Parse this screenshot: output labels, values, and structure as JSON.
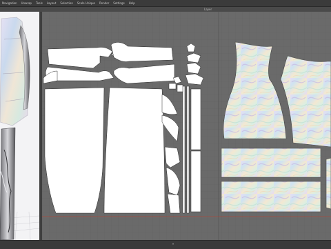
{
  "menubar": {
    "items": [
      "Navigation",
      "Unwrap",
      "Tools",
      "Layout",
      "Selection",
      "Scale Unique",
      "Render",
      "Settings",
      "Help"
    ]
  },
  "window": {
    "title": "Layer"
  },
  "colors": {
    "background": "#565656",
    "viewport_bg": "#6b6b6b",
    "grid_line": "#5e5e5e",
    "uv_island": "#ffffff",
    "uv_outline": "#2c2c2c",
    "baseline": "#c0392b",
    "avatar_bg": "#f3f3f5"
  },
  "icons": [
    "grid-icon",
    "uv-island-icon",
    "avatar-icon"
  ]
}
